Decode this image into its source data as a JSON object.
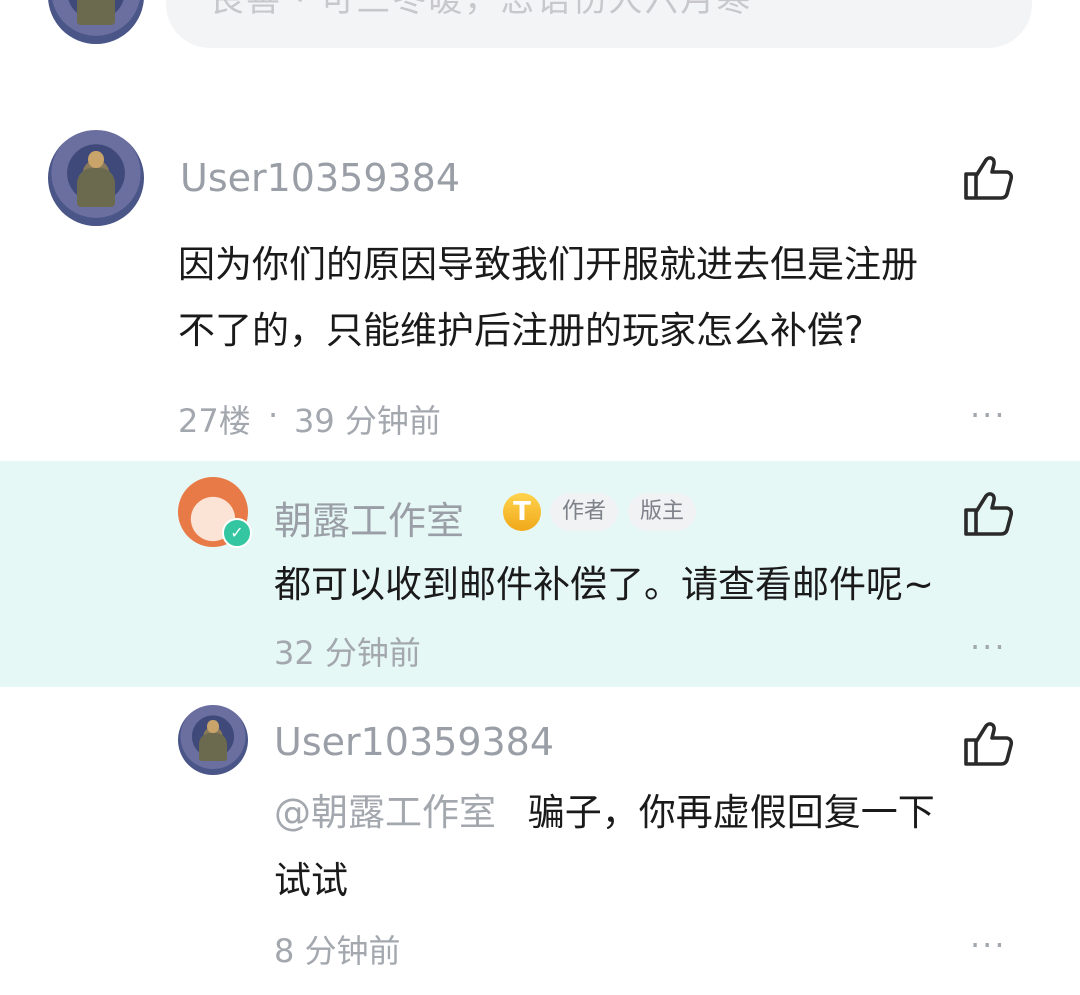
{
  "top": {
    "placeholder": "良善 · 可三冬暖，恶语伤人六月寒"
  },
  "comment": {
    "user": "User10359384",
    "text_line1": "因为你们的原因导致我们开服就进去但是注册",
    "text_line2": "不了的，只能维护后注册的玩家怎么补偿?",
    "floor": "27楼",
    "dot": "·",
    "time": "39 分钟前",
    "more": "···"
  },
  "reply1": {
    "user": "朝露工作室",
    "coin_badge": "T",
    "tag_author": "作者",
    "tag_moderator": "版主",
    "text": "都可以收到邮件补偿了。请查看邮件呢~",
    "time": "32 分钟前",
    "more": "···"
  },
  "reply2": {
    "user": "User10359384",
    "mention": "@朝露工作室",
    "text_line1": "骗子，你再虚假回复一下",
    "text_line2": "试试",
    "time": "8 分钟前",
    "more": "···"
  },
  "colors": {
    "highlight_bg": "#e6f8f6",
    "muted_text": "#a3a7ae",
    "coin": "#f0a81a"
  }
}
